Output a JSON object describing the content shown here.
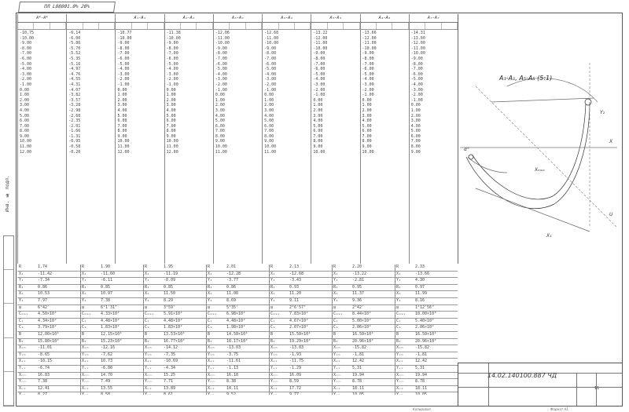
{
  "document": {
    "top_code": "ПЛ L88001.0% 20%",
    "drawing_label": "A₁-A₁, A₅-A₅ (5:1)",
    "title_block_code": "14.02.140100.887 ЧД",
    "sheet_number": "11",
    "footer_left": "Копировал",
    "footer_right": "Формат  А1"
  },
  "upper_columns": [
    {
      "head": "А*-А*",
      "values": "-10.75\n-10.00\n-9.00\n-8.00\n-7.00\n-6.00\n-5.00\n-4.00\n-3.00\n-2.00\n-1.00\n0.00\n1.00\n2.00\n3.00\n4.00\n5.00\n6.00\n7.00\n8.00\n9.00\n10.00\n11.00\n12.00"
    },
    {
      "head": "",
      "values": "-6.14\n-6.00\n-5.86\n-5.70\n-5.52\n-5.35\n-5.16\n-4.97\n-4.76\n-4.55\n-4.31\n-4.07\n-3.82\n-3.57\n-3.28\n-2.98\n-2.68\n-2.35\n-2.01\n-1.66\n-1.31\n-0.95\n-0.58\n-0.20"
    },
    {
      "head": "А₁-А₁",
      "values": "-10.77\n-10.00\n-9.00\n-8.00\n-7.00\n-6.00\n-5.00\n-4.00\n-3.00\n-2.00\n-1.00\n0.00\n1.00\n2.00\n3.00\n4.00\n5.00\n6.00\n7.00\n8.00\n9.00\n10.00\n11.00\n12.00"
    },
    {
      "head": "А₂-А₂",
      "values": "-11.38\n-10.00\n-9.00\n-8.00\n-7.00\n-6.00\n-5.00\n-4.00\n-3.00\n-2.00\n-1.00\n0.00\n1.00\n2.00\n3.00\n4.00\n5.00\n6.00\n7.00\n8.00\n9.00\n10.00\n11.00\n12.00"
    },
    {
      "head": "А₃-А₃",
      "values": "-12.06\n-11.00\n-10.00\n-9.00\n-8.00\n-7.00\n-6.00\n-5.00\n-4.00\n-3.00\n-2.00\n-1.00\n0.00\n1.00\n2.00\n3.00\n4.00\n5.00\n6.00\n7.00\n8.00\n9.00\n10.00\n11.00"
    },
    {
      "head": "А₄-А₄",
      "values": "-12.68\n-11.00\n-10.00\n-9.00\n-8.00\n-7.00\n-6.00\n-5.00\n-4.00\n-3.00\n-2.00\n-1.00\n0.00\n1.00\n2.00\n3.00\n4.00\n5.00\n6.00\n7.00\n8.00\n9.00\n10.00\n11.00"
    },
    {
      "head": "А₅-А₅",
      "values": "-13.22\n-12.00\n-11.00\n-10.00\n-9.00\n-8.00\n-7.00\n-6.00\n-5.00\n-4.00\n-3.00\n-2.00\n-1.00\n0.00\n1.00\n2.00\n3.00\n4.00\n5.00\n6.00\n7.00\n8.00\n9.00\n10.00"
    },
    {
      "head": "А₆-А₆",
      "values": "-13.66\n-12.00\n-11.00\n-10.00\n-9.00\n-8.00\n-7.00\n-6.00\n-5.00\n-4.00\n-3.00\n-2.00\n-1.00\n0.00\n1.00\n2.00\n3.00\n4.00\n5.00\n6.00\n7.00\n8.00\n9.00\n10.00"
    },
    {
      "head": "А₇-А₇",
      "values": "-14.31\n-13.00\n-12.00\n-11.00\n-10.00\n-9.00\n-8.00\n-7.00\n-6.00\n-5.00\n-4.00\n-3.00\n-2.00\n-1.00\n0.00\n1.00\n2.00\n3.00\n4.00\n5.00\n6.00\n7.00\n8.00\n9.00"
    }
  ],
  "lower_rows": [
    {
      "label": "R",
      "values": [
        "1.74",
        "1.90",
        "1.95",
        "2.01",
        "2.13",
        "2.20",
        "2.33"
      ]
    },
    {
      "label": "X₁",
      "values": [
        "-11.42",
        "-11.60",
        "-11.19",
        "-12.28",
        "-12.68",
        "-13.22",
        "-13.66"
      ]
    },
    {
      "label": "Y₁",
      "values": [
        "-7.34",
        "-6.11",
        "-0.09",
        "-3.77",
        "-3.43",
        "-2.81",
        "4.30"
      ]
    },
    {
      "label": "R₁",
      "values": [
        "0.86",
        "0.85",
        "0.85",
        "0.86",
        "0.93",
        "0.95",
        "0.97"
      ]
    },
    {
      "label": "X₂",
      "values": [
        "10.53",
        "10.97",
        "11.50",
        "11.08",
        "11.20",
        "11.37",
        "11.99"
      ]
    },
    {
      "label": "Y₂",
      "values": [
        "7.97",
        "7.38",
        "8.29",
        "8.69",
        "9.11",
        "9.36",
        "8.16"
      ]
    },
    {
      "label": "α",
      "values": [
        "6°42'",
        "6°1'31\"",
        "3°59'",
        "5°35'",
        "2°6'57\"",
        "2°42'",
        "1°12'56\""
      ]
    },
    {
      "label": "Cₘₐₓ",
      "values": [
        "4.50×10²",
        "4.33×10²",
        "5.91×10²",
        "6.98×10²",
        "7.83×10²",
        "8.44×10²",
        "10.00×10²"
      ]
    },
    {
      "label": "Cₓ",
      "values": [
        "4.34×10²",
        "4.48×10²",
        "4.48×10²",
        "4.48×10²",
        "4.67×10²",
        "5.00×10²",
        "5.40×10²"
      ]
    },
    {
      "label": "C₁",
      "values": [
        "3.79×10²",
        "1.83×10²",
        "1.83×10²",
        "1.98×10²",
        "2.07×10²",
        "2.06×10²",
        "2.06×10²"
      ]
    },
    {
      "label": "B",
      "values": [
        "12.00×10⁴",
        "12.15×10⁴",
        "13.53×10⁴",
        "14.50×10⁴",
        "15.50×10⁴",
        "16.50×10⁴",
        "16.50×10⁴"
      ]
    },
    {
      "label": "B₁",
      "values": [
        "15.80×10²",
        "15.23×10²",
        "16.77×10²",
        "18.17×10²",
        "19.29×10²",
        "20.96×10²",
        "20.96×10²"
      ]
    },
    {
      "label": "Xᵥₕ",
      "values": [
        "-11.01",
        "-12.16",
        "-14.12",
        "-13.03",
        "-13.83",
        "-15.82",
        "-15.82"
      ]
    },
    {
      "label": "Yᵥₕ",
      "values": [
        "-8.65",
        "-7.62",
        "-7.35",
        "-3.75",
        "-1.93",
        "-1.81",
        "-1.81"
      ]
    },
    {
      "label": "Xᵥₓ",
      "values": [
        "-10.15",
        "10.73",
        "-10.69",
        "-11.61",
        "-11.75",
        "12.42",
        "12.42"
      ]
    },
    {
      "label": "Yᵥₓ",
      "values": [
        "-6.74",
        "-6.80",
        "-4.34",
        "-1.13",
        "-1.29",
        "5.31",
        "5.31"
      ]
    },
    {
      "label": "Xₙₙ",
      "values": [
        "16.83",
        "14.70",
        "15.25",
        "16.18",
        "16.09",
        "19.94",
        "19.94"
      ]
    },
    {
      "label": "Yₙₙ",
      "values": [
        "7.38",
        "7.49",
        "7.71",
        "8.38",
        "8.59",
        "8.78",
        "8.78"
      ]
    },
    {
      "label": "Xₙₓ",
      "values": [
        "12.41",
        "13.55",
        "13.89",
        "14.11",
        "17.72",
        "18.11",
        "18.11"
      ]
    },
    {
      "label": "Yₙₓ",
      "values": [
        "8.27",
        "8.58",
        "8.61",
        "9.52",
        "9.77",
        "10.05",
        "10.05"
      ]
    }
  ]
}
